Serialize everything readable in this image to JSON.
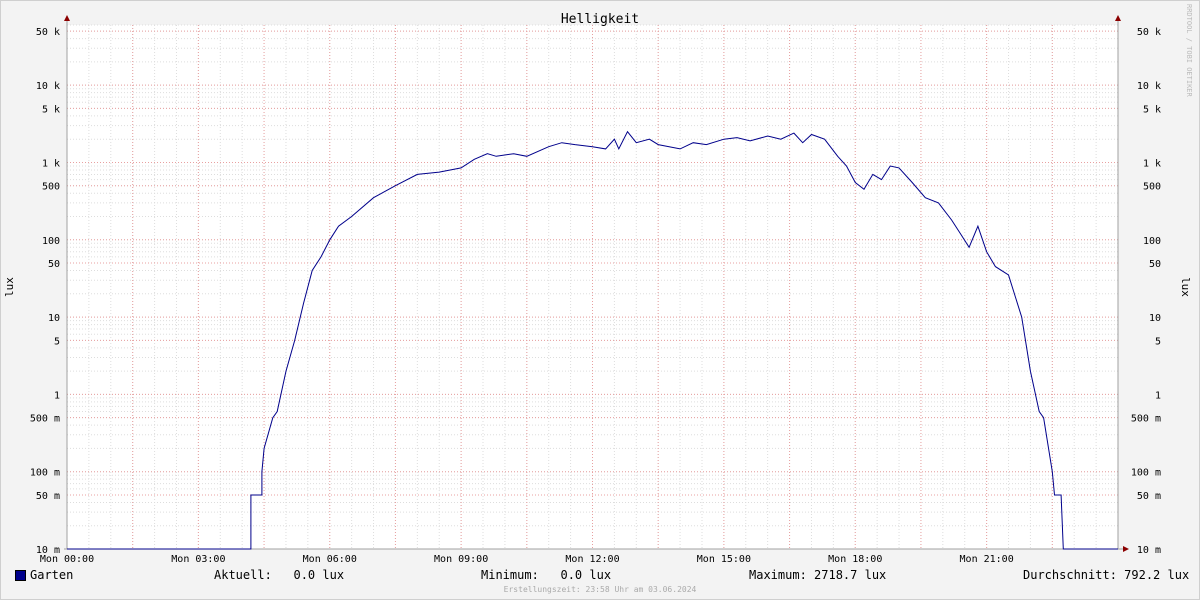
{
  "chart_data": {
    "type": "line",
    "title": "Helligkeit",
    "ylabel": "lux",
    "yscale": "log",
    "ylim": [
      0.01,
      60000
    ],
    "xlim": [
      0,
      24
    ],
    "grid": true,
    "x_ticks": [
      {
        "x": 0,
        "label": "Mon 00:00"
      },
      {
        "x": 3,
        "label": "Mon 03:00"
      },
      {
        "x": 6,
        "label": "Mon 06:00"
      },
      {
        "x": 9,
        "label": "Mon 09:00"
      },
      {
        "x": 12,
        "label": "Mon 12:00"
      },
      {
        "x": 15,
        "label": "Mon 15:00"
      },
      {
        "x": 18,
        "label": "Mon 18:00"
      },
      {
        "x": 21,
        "label": "Mon 21:00"
      }
    ],
    "y_ticks": [
      {
        "v": 0.01,
        "label": "10 m"
      },
      {
        "v": 0.05,
        "label": "50 m"
      },
      {
        "v": 0.1,
        "label": "100 m"
      },
      {
        "v": 0.5,
        "label": "500 m"
      },
      {
        "v": 1,
        "label": "1"
      },
      {
        "v": 5,
        "label": "5"
      },
      {
        "v": 10,
        "label": "10"
      },
      {
        "v": 50,
        "label": "50"
      },
      {
        "v": 100,
        "label": "100"
      },
      {
        "v": 500,
        "label": "500"
      },
      {
        "v": 1000,
        "label": "1 k"
      },
      {
        "v": 5000,
        "label": "5 k"
      },
      {
        "v": 10000,
        "label": "10 k"
      },
      {
        "v": 50000,
        "label": "50 k"
      }
    ],
    "series": [
      {
        "name": "Garten",
        "color": "#00008b",
        "points": [
          [
            0,
            0.01
          ],
          [
            3.9,
            0.01
          ],
          [
            4.2,
            0.01
          ],
          [
            4.2,
            0.05
          ],
          [
            4.45,
            0.05
          ],
          [
            4.45,
            0.1
          ],
          [
            4.5,
            0.2
          ],
          [
            4.7,
            0.5
          ],
          [
            4.8,
            0.6
          ],
          [
            5.0,
            2
          ],
          [
            5.2,
            5
          ],
          [
            5.4,
            15
          ],
          [
            5.6,
            40
          ],
          [
            5.8,
            60
          ],
          [
            6.0,
            100
          ],
          [
            6.2,
            150
          ],
          [
            6.5,
            200
          ],
          [
            7.0,
            350
          ],
          [
            7.5,
            500
          ],
          [
            8.0,
            700
          ],
          [
            8.5,
            750
          ],
          [
            9.0,
            850
          ],
          [
            9.3,
            1100
          ],
          [
            9.6,
            1300
          ],
          [
            9.8,
            1200
          ],
          [
            10.2,
            1300
          ],
          [
            10.5,
            1200
          ],
          [
            11.0,
            1600
          ],
          [
            11.3,
            1800
          ],
          [
            11.6,
            1700
          ],
          [
            12.0,
            1600
          ],
          [
            12.3,
            1500
          ],
          [
            12.5,
            2000
          ],
          [
            12.6,
            1500
          ],
          [
            12.8,
            2500
          ],
          [
            13.0,
            1800
          ],
          [
            13.3,
            2000
          ],
          [
            13.5,
            1700
          ],
          [
            14.0,
            1500
          ],
          [
            14.3,
            1800
          ],
          [
            14.6,
            1700
          ],
          [
            15.0,
            2000
          ],
          [
            15.3,
            2100
          ],
          [
            15.6,
            1900
          ],
          [
            16.0,
            2200
          ],
          [
            16.3,
            2000
          ],
          [
            16.6,
            2400
          ],
          [
            16.8,
            1800
          ],
          [
            17.0,
            2300
          ],
          [
            17.3,
            2000
          ],
          [
            17.6,
            1200
          ],
          [
            17.8,
            900
          ],
          [
            18.0,
            550
          ],
          [
            18.2,
            450
          ],
          [
            18.4,
            700
          ],
          [
            18.6,
            600
          ],
          [
            18.8,
            900
          ],
          [
            19.0,
            850
          ],
          [
            19.3,
            550
          ],
          [
            19.6,
            350
          ],
          [
            19.9,
            300
          ],
          [
            20.2,
            180
          ],
          [
            20.4,
            120
          ],
          [
            20.6,
            80
          ],
          [
            20.8,
            150
          ],
          [
            21.0,
            70
          ],
          [
            21.2,
            45
          ],
          [
            21.5,
            35
          ],
          [
            21.8,
            10
          ],
          [
            22.0,
            2
          ],
          [
            22.2,
            0.6
          ],
          [
            22.3,
            0.5
          ],
          [
            22.5,
            0.1
          ],
          [
            22.55,
            0.05
          ],
          [
            22.7,
            0.05
          ],
          [
            22.75,
            0.01
          ],
          [
            24,
            0.01
          ]
        ]
      }
    ]
  },
  "legend": {
    "series_name": "Garten",
    "current": "Aktuell:   0.0 lux",
    "minimum": "Minimum:   0.0 lux",
    "maximum": "Maximum: 2718.7 lux",
    "average": "Durchschnitt: 792.2 lux"
  },
  "footer": "Erstellungszeit: 23:58 Uhr am 03.06.2024",
  "watermark": "RRDTOOL / TOBI OETIKER"
}
